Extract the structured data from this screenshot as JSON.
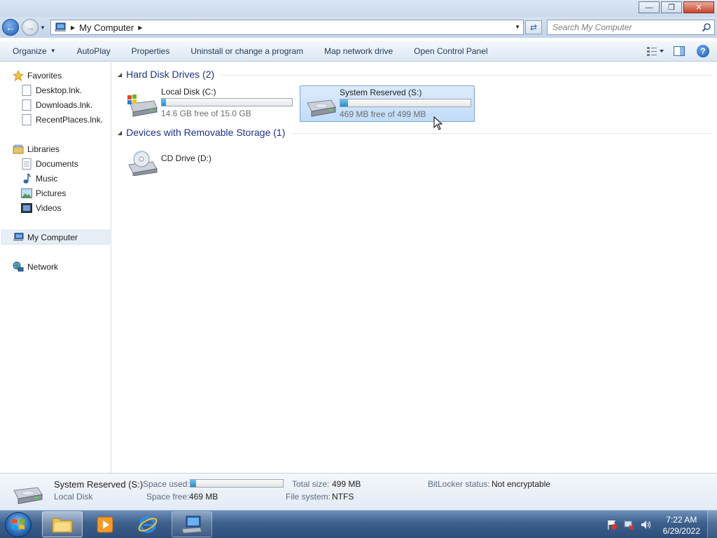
{
  "window": {
    "minimize_glyph": "—",
    "maximize_glyph": "❐",
    "close_glyph": "✕"
  },
  "nav": {
    "back_glyph": "←",
    "forward_glyph": "→",
    "address_text": "My Computer",
    "crumb_sep": "▶",
    "search_placeholder": "Search My Computer",
    "refresh_glyph": "⇄"
  },
  "toolbar": {
    "organize": "Organize",
    "autoplay": "AutoPlay",
    "properties": "Properties",
    "uninstall": "Uninstall or change a program",
    "map_drive": "Map network drive",
    "control_panel": "Open Control Panel",
    "help_glyph": "?"
  },
  "sidebar": {
    "favorites": "Favorites",
    "favorites_items": [
      "Desktop.lnk.",
      "Downloads.lnk.",
      "RecentPlaces.lnk."
    ],
    "libraries": "Libraries",
    "libraries_items": [
      "Documents",
      "Music",
      "Pictures",
      "Videos"
    ],
    "my_computer": "My Computer",
    "network": "Network"
  },
  "content": {
    "hdd_group": "Hard Disk Drives (2)",
    "removable_group": "Devices with Removable Storage (1)",
    "drives": [
      {
        "name": "Local Disk (C:)",
        "free_text": "14.6 GB free of 15.0 GB",
        "used_fraction": 0.03
      },
      {
        "name": "System Reserved (S:)",
        "free_text": "469 MB free of 499 MB",
        "used_fraction": 0.06
      }
    ],
    "cd_drive": "CD Drive (D:)"
  },
  "details": {
    "name": "System Reserved (S:)",
    "type": "Local Disk",
    "space_used_label": "Space used:",
    "space_used_fraction": 0.06,
    "space_free_label": "Space free:",
    "space_free_value": "469 MB",
    "total_size_label": "Total size:",
    "total_size_value": "499 MB",
    "file_system_label": "File system:",
    "file_system_value": "NTFS",
    "bitlocker_label": "BitLocker status:",
    "bitlocker_value": "Not encryptable"
  },
  "taskbar": {
    "time": "7:22 AM",
    "date": "6/29/2022"
  },
  "colors": {
    "accent": "#1e3287",
    "selection": "#c1dcf8",
    "usage_bar": "#1f8cc9"
  }
}
